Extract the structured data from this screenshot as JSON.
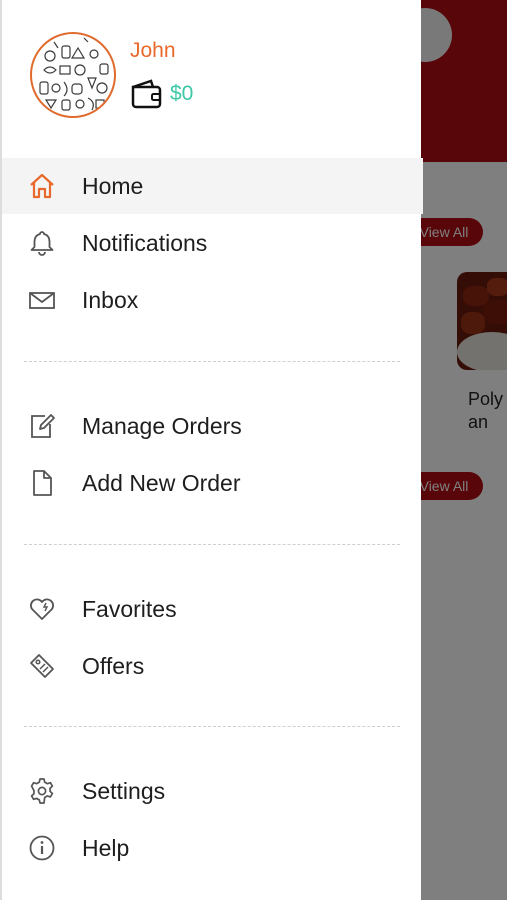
{
  "background": {
    "view_all_1": "View All",
    "view_all_2": "View All",
    "food_title": "Polynesian"
  },
  "profile": {
    "name": "John",
    "wallet_amount": "$0"
  },
  "menu": {
    "home": "Home",
    "notifications": "Notifications",
    "inbox": "Inbox",
    "manage_orders": "Manage Orders",
    "add_new_order": "Add New Order",
    "favorites": "Favorites",
    "offers": "Offers",
    "settings": "Settings",
    "help": "Help"
  },
  "colors": {
    "accent_orange": "#e9692c",
    "wallet_green": "#3cc7a6",
    "brand_red": "#b00d12"
  },
  "icons": [
    "home-icon",
    "bell-icon",
    "envelope-icon",
    "edit-icon",
    "document-icon",
    "heart-icon",
    "tag-icon",
    "gear-icon",
    "info-icon",
    "wallet-icon"
  ]
}
